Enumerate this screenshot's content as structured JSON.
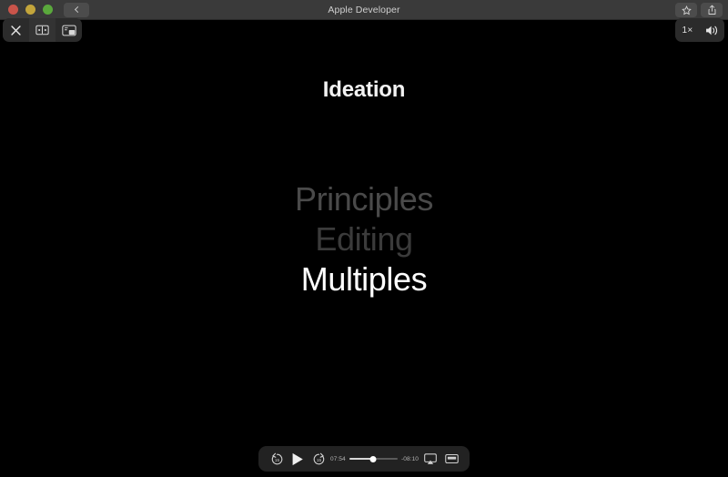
{
  "window": {
    "title": "Apple Developer",
    "traffic_lights": [
      {
        "name": "close",
        "color": "#c9544a"
      },
      {
        "name": "minimize",
        "color": "#c3a53b"
      },
      {
        "name": "zoom",
        "color": "#5aa83c"
      }
    ],
    "back_button_icon": "chevron-left-icon",
    "toolbar_right": [
      {
        "name": "favorite-button",
        "icon": "star-icon"
      },
      {
        "name": "share-button",
        "icon": "share-icon"
      }
    ]
  },
  "player_overlay": {
    "top_left": [
      {
        "name": "close-player-button",
        "icon": "close-x-icon"
      },
      {
        "name": "chapters-button",
        "icon": "chapters-icon"
      },
      {
        "name": "picture-in-picture-button",
        "icon": "picture-in-picture-icon"
      }
    ],
    "top_right": {
      "speed_label": "1×",
      "volume_icon": "volume-high-icon"
    }
  },
  "slide": {
    "title": "Ideation",
    "agenda": [
      {
        "label": "Principles",
        "state": "past"
      },
      {
        "label": "Editing",
        "state": "past"
      },
      {
        "label": "Multiples",
        "state": "current"
      }
    ]
  },
  "controls": {
    "skip_back_label": "15",
    "skip_forward_label": "15",
    "play_icon": "play-icon",
    "current_time": "07:54",
    "remaining_time": "-08:10",
    "progress_percent": 49,
    "airplay_icon": "airplay-icon",
    "fullscreen_icon": "fullscreen-icon"
  },
  "colors": {
    "titlebar_bg": "#3a3a3a",
    "content_bg": "#000000",
    "control_bg": "#222222",
    "accent_text": "#ffffff",
    "dim_text": "#4a4a4a"
  }
}
